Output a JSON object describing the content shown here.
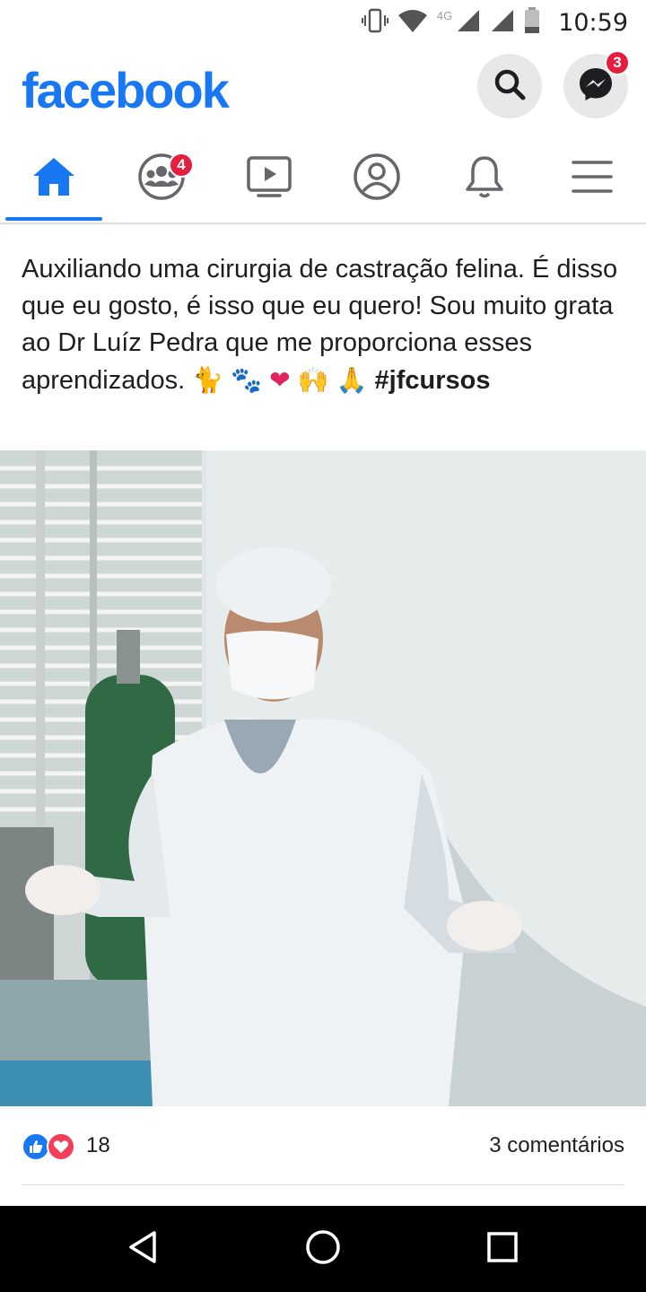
{
  "status_bar": {
    "time": "10:59",
    "network": "4G",
    "icons": [
      "vibrate-icon",
      "wifi-icon",
      "signal-icon",
      "signal-icon",
      "battery-icon"
    ]
  },
  "header": {
    "logo": "facebook",
    "search_icon": "search-icon",
    "messenger_icon": "messenger-icon",
    "messenger_badge": "3",
    "brand_color": "#1877f2"
  },
  "tabs": [
    {
      "name": "home",
      "icon": "home-icon",
      "active": true
    },
    {
      "name": "groups",
      "icon": "groups-icon",
      "badge": "4"
    },
    {
      "name": "watch",
      "icon": "video-icon"
    },
    {
      "name": "profile",
      "icon": "profile-icon"
    },
    {
      "name": "notifications",
      "icon": "bell-icon"
    },
    {
      "name": "menu",
      "icon": "menu-icon"
    }
  ],
  "post": {
    "text_line1": "Auxiliando uma cirurgia de castração felina. É disso que eu gosto, é isso que eu quero! Sou muito grata ao Dr Luíz Pedra que me proporciona esses aprendizados. ",
    "emoji_cat": "🐈",
    "emoji_paws": "🐾",
    "emoji_heart": "❤",
    "emoji_hands": "🙌",
    "emoji_pray": "🙏",
    "hashtag": "#jfcursos",
    "reactions_count": "18",
    "comments": "3 comentários",
    "reaction_icons": [
      "like-icon",
      "love-icon"
    ]
  },
  "android_nav": [
    "back-icon",
    "home-circle-icon",
    "recents-icon"
  ]
}
